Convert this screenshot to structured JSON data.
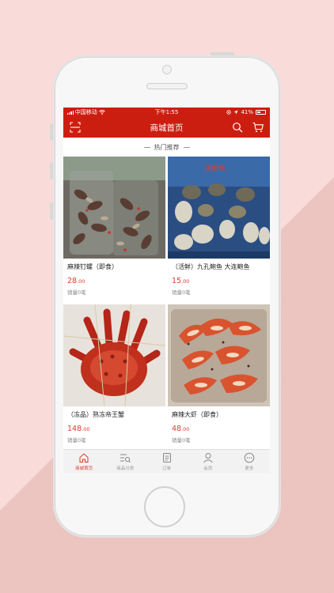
{
  "status_bar": {
    "carrier": "中国移动",
    "time": "下午1:55",
    "battery": "41%"
  },
  "nav": {
    "title": "商城首页",
    "left_icon": "scan-icon",
    "right_icons": [
      "search-icon",
      "cart-icon"
    ]
  },
  "section": {
    "title": "热门推荐"
  },
  "products": [
    {
      "name": "麻辣钉螺（即食）",
      "price_int": "28",
      "price_dec": ".00",
      "sales": "销量0笔",
      "image": "spicy-snails"
    },
    {
      "name": "（活鲜）九孔鲍鱼 大连鲍鱼",
      "price_int": "15",
      "price_dec": ".00",
      "sales": "销量0笔",
      "image": "abalone"
    },
    {
      "name": "（冻品）熟冻帝王蟹",
      "price_int": "148",
      "price_dec": ".00",
      "sales": "销量0笔",
      "image": "king-crab"
    },
    {
      "name": "麻辣大虾（即食）",
      "price_int": "48",
      "price_dec": ".00",
      "sales": "销量0笔",
      "image": "spicy-shrimp"
    }
  ],
  "tabs": [
    {
      "label": "商城首页",
      "icon": "home-icon",
      "active": true
    },
    {
      "label": "商品分类",
      "icon": "category-search-icon",
      "active": false
    },
    {
      "label": "订单",
      "icon": "order-icon",
      "active": false
    },
    {
      "label": "会员",
      "icon": "member-icon",
      "active": false
    },
    {
      "label": "更多",
      "icon": "more-icon",
      "active": false
    }
  ],
  "colors": {
    "brand_red": "#cc1e10",
    "price_red": "#e03a2a",
    "background": "#f9dcd9"
  }
}
